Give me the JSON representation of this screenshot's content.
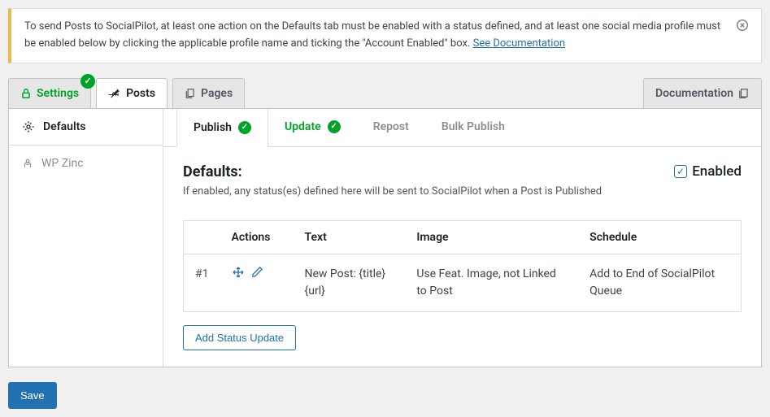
{
  "notice": {
    "text_before_link": "To send Posts to SocialPilot, at least one action on the Defaults tab must be enabled with a status defined, and at least one social media profile must be enabled below by clicking the applicable profile name and ticking the \"Account Enabled\" box. ",
    "link_text": "See Documentation"
  },
  "tabs": {
    "settings": "Settings",
    "posts": "Posts",
    "pages": "Pages",
    "documentation": "Documentation"
  },
  "sidebar": {
    "defaults": "Defaults",
    "wpzinc": "WP Zinc"
  },
  "subtabs": {
    "publish": "Publish",
    "update": "Update",
    "repost": "Repost",
    "bulk": "Bulk Publish"
  },
  "defaults": {
    "heading": "Defaults:",
    "enabled_label": "Enabled",
    "description": "If enabled, any status(es) defined here will be sent to SocialPilot when a Post is Published"
  },
  "table": {
    "headers": {
      "num": "",
      "actions": "Actions",
      "text": "Text",
      "image": "Image",
      "schedule": "Schedule"
    },
    "rows": [
      {
        "num": "#1",
        "text": "New Post: {title} {url}",
        "image": "Use Feat. Image, not Linked to Post",
        "schedule": "Add to End of SocialPilot Queue"
      }
    ]
  },
  "buttons": {
    "add_status": "Add Status Update",
    "save": "Save"
  }
}
